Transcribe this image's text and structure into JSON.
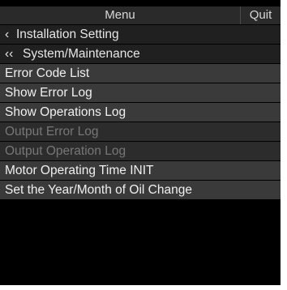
{
  "header": {
    "title": "Menu",
    "quit_label": "Quit"
  },
  "menu": {
    "items": [
      {
        "label": "Installation Setting",
        "chevron": "‹",
        "kind": "nav"
      },
      {
        "label": "System/Maintenance",
        "chevron": "‹‹",
        "kind": "nav"
      },
      {
        "label": "Error Code List",
        "kind": "cmd"
      },
      {
        "label": "Show Error Log",
        "kind": "cmd"
      },
      {
        "label": "Show Operations Log",
        "kind": "cmd"
      },
      {
        "label": "Output Error Log",
        "kind": "disabled"
      },
      {
        "label": "Output Operation Log",
        "kind": "disabled"
      },
      {
        "label": "Motor Operating Time INIT",
        "kind": "cmd"
      },
      {
        "label": "Set the Year/Month of Oil Change",
        "kind": "cmd"
      }
    ]
  },
  "colors": {
    "background": "#000000",
    "titlebar": "#2a2a2a",
    "item_enabled": "#3a3a3a",
    "item_disabled_text": "#777777"
  }
}
